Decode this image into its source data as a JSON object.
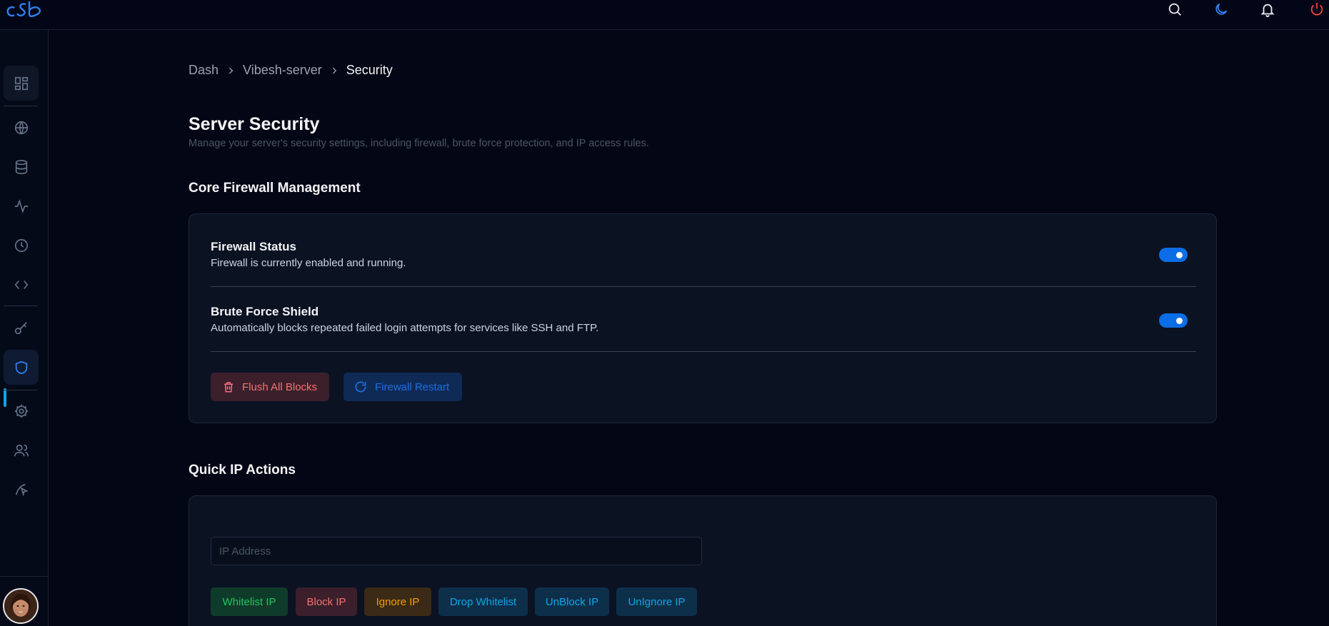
{
  "header": {
    "logo_text": "cSb",
    "icons": [
      "search-icon",
      "moon-icon",
      "bell-icon",
      "power-icon"
    ]
  },
  "sidebar": {
    "items": [
      {
        "name": "dashboard",
        "icon": "grid-icon"
      },
      {
        "name": "websites",
        "icon": "globe-icon"
      },
      {
        "name": "databases",
        "icon": "database-icon"
      },
      {
        "name": "monitoring",
        "icon": "activity-icon"
      },
      {
        "name": "cron",
        "icon": "clock-icon"
      },
      {
        "name": "code",
        "icon": "code-icon"
      },
      {
        "name": "keys",
        "icon": "key-icon"
      },
      {
        "name": "security",
        "icon": "shield-icon",
        "active": true
      },
      {
        "name": "settings",
        "icon": "gear-icon"
      },
      {
        "name": "users",
        "icon": "users-icon"
      },
      {
        "name": "deploy",
        "icon": "pointer-icon"
      }
    ]
  },
  "breadcrumb": {
    "items": [
      "Dash",
      "Vibesh-server",
      "Security"
    ]
  },
  "page": {
    "title": "Server Security",
    "subtitle": "Manage your server's security settings, including firewall, brute force protection, and IP access rules."
  },
  "firewall": {
    "section_title": "Core Firewall Management",
    "rows": [
      {
        "title": "Firewall Status",
        "description": "Firewall is currently enabled and running.",
        "enabled": true
      },
      {
        "title": "Brute Force Shield",
        "description": "Automatically blocks repeated failed login attempts for services like SSH and FTP.",
        "enabled": true
      }
    ],
    "flush_label": "Flush All Blocks",
    "restart_label": "Firewall Restart"
  },
  "ip_actions": {
    "section_title": "Quick IP Actions",
    "input_placeholder": "IP Address",
    "input_value": "",
    "buttons": {
      "whitelist": "Whitelist IP",
      "block": "Block IP",
      "ignore": "Ignore IP",
      "drop_whitelist": "Drop Whitelist",
      "unblock": "UnBlock IP",
      "unignore": "UnIgnore IP"
    }
  },
  "colors": {
    "accent": "#0b6ee6",
    "danger": "#f87171",
    "success": "#22c55e",
    "warning": "#f59e0b",
    "info": "#0ea5e9",
    "active_indicator": "#0ea5e9"
  }
}
